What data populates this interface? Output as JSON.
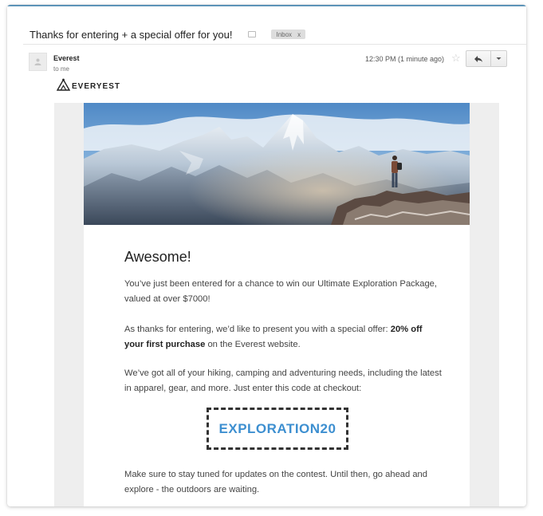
{
  "email": {
    "subject": "Thanks for entering + a special offer for you!",
    "label": "Inbox",
    "label_remove": "x",
    "sender": "Everest",
    "recipient": "to me",
    "time": "12:30 PM (1 minute ago)"
  },
  "icons": {
    "label": "label-tag-icon",
    "avatar": "person-icon",
    "star": "star-icon",
    "reply": "reply-arrow-icon",
    "more": "chevron-down-icon",
    "brand": "mountain-logo-icon"
  },
  "message": {
    "brand_name": "EVERYEST",
    "heading": "Awesome!",
    "p1": "You’ve just been entered for a chance to win our Ultimate Exploration Package, valued at over $7000!",
    "p2_lead": "As thanks for entering, we’d like to present you with a special offer: ",
    "p2_bold": "20% off your first purchase",
    "p2_tail": " on the Everest website.",
    "p3": "We’ve got all of your hiking, camping and adventuring needs, including the latest in apparel, gear, and more. Just enter this code at checkout:",
    "coupon_code": "EXPLORATION20",
    "p4": "Make sure to stay tuned for updates on the contest. Until then, go ahead and explore - the outdoors are waiting."
  },
  "colors": {
    "accent_line": "#5c93b8",
    "coupon_text": "#3d8fd0",
    "panel_bg": "#eeeeee"
  }
}
